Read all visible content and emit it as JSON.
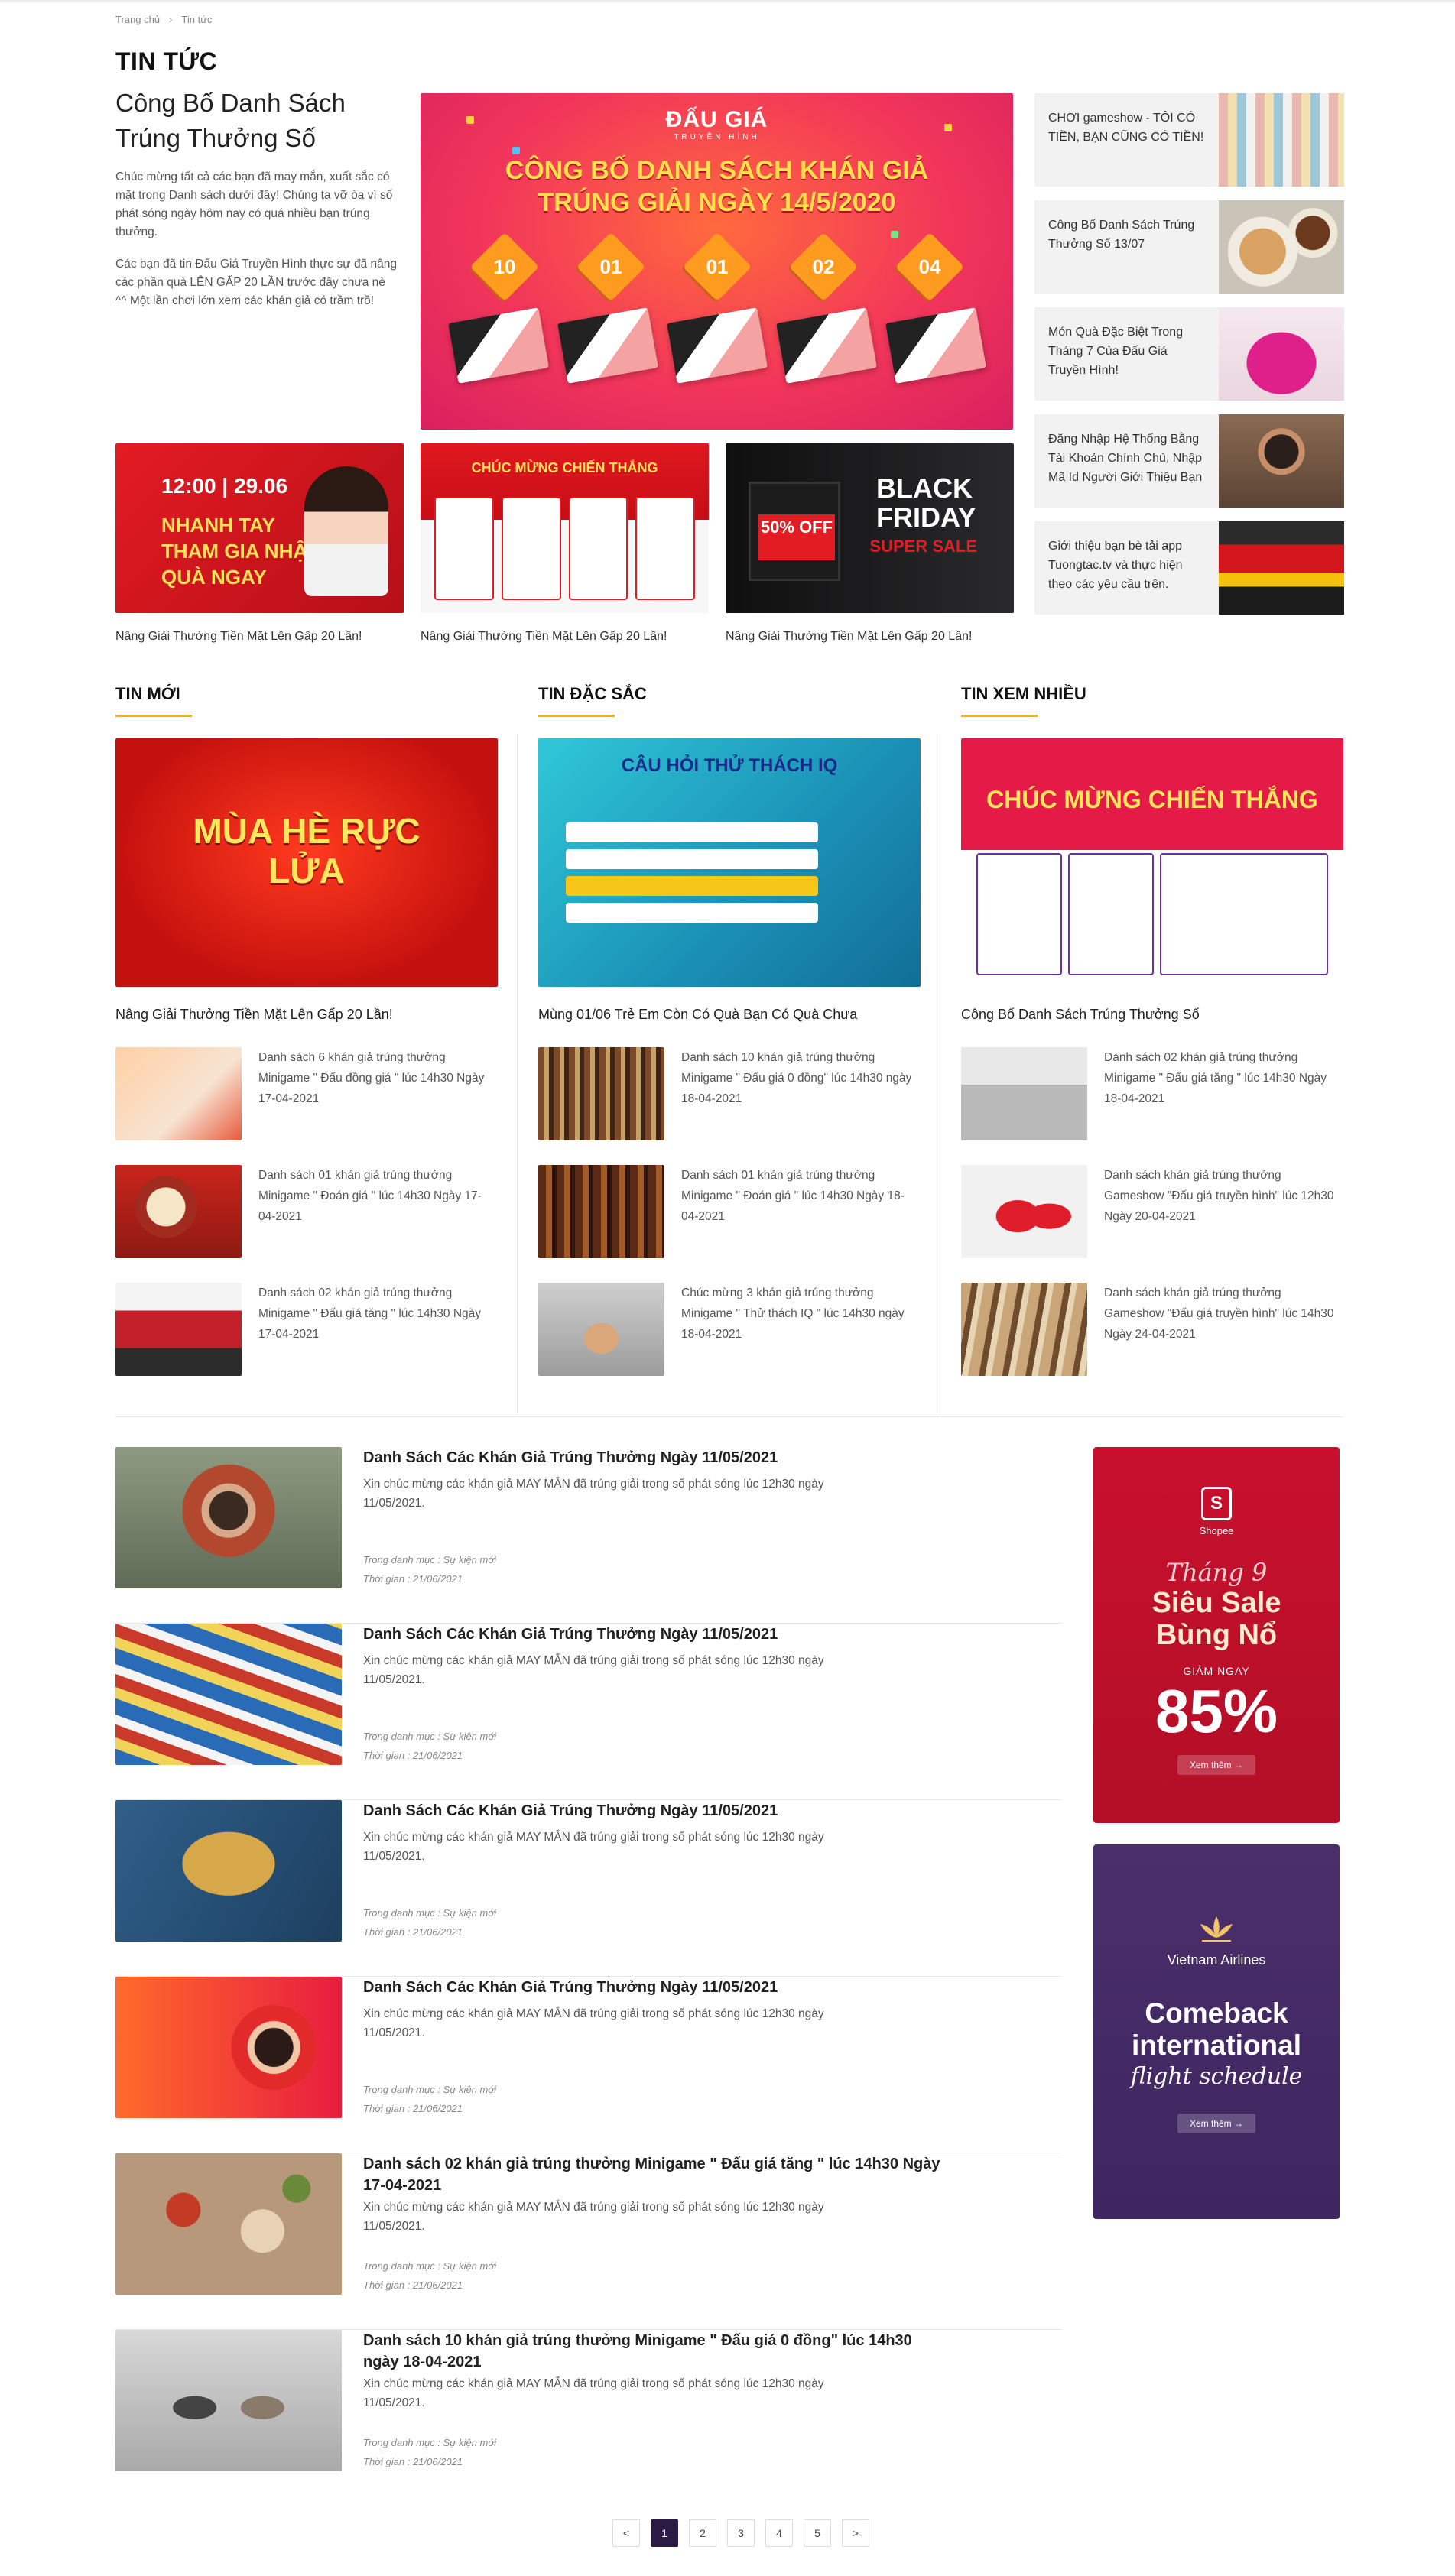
{
  "breadcrumb": {
    "home": "Trang chủ",
    "current": "Tin tức"
  },
  "page_title": "TIN TỨC",
  "featured": {
    "title": "Công Bố Danh Sách Trúng Thưởng Số",
    "p1": "Chúc mừng tất cả các bạn đã may mắn, xuất sắc có mặt trong Danh sách dưới đây! Chúng ta vỡ òa vì số phát sóng ngày hôm nay có quá nhiều bạn trúng thưởng.",
    "p2": "Các bạn đã tin Đấu Giá Truyền Hình thực sự đã nâng các phần quà LÊN GẤP 20 LẦN trước đây chưa nè ^^ Một lần chơi lớn xem các khán giả có trầm trồ!"
  },
  "hero": {
    "brand": "ĐẤU GIÁ",
    "brand_sub": "TRUYỀN HÌNH",
    "headline_1": "CÔNG BỐ DANH SÁCH KHÁN GIẢ",
    "headline_2": "TRÚNG GIẢI NGÀY 14/5/2020",
    "tags": [
      "10",
      "01",
      "01",
      "02",
      "04"
    ]
  },
  "side_list": [
    {
      "title": "CHƠI gameshow - TÔI CÓ TIỀN, BẠN CŨNG CÓ TIỀN!"
    },
    {
      "title": "Công Bố Danh Sách Trúng Thưởng Số 13/07"
    },
    {
      "title": "Món Quà Đặc Biệt Trong Tháng 7 Của Đấu Giá Truyền Hình!"
    },
    {
      "title": "Đăng Nhập Hệ Thống Bằng Tài Khoản Chính Chủ, Nhập Mã Id Người Giới Thiệu Bạn"
    },
    {
      "title": "Giới thiệu bạn bè tải app Tuongtac.tv và thực hiện theo các yêu cầu trên."
    }
  ],
  "mini_banners": [
    {
      "caption": "Nâng Giải Thưởng Tiền Mặt Lên Gấp 20 Lần!",
      "l1": "12:00 | 29.06",
      "l2": "NHANH TAY THAM GIA NHẬN QUÀ NGAY"
    },
    {
      "caption": "Nâng Giải Thưởng Tiền Mặt Lên Gấp 20 Lần!",
      "l1": "CHÚC MỪNG CHIẾN THẮNG"
    },
    {
      "caption": "Nâng Giải Thưởng Tiền Mặt Lên Gấp 20 Lần!",
      "l1": "BLACK FRIDAY",
      "l2": "SUPER SALE",
      "l3": "50% OFF"
    }
  ],
  "sections": [
    {
      "title": "TIN MỚI",
      "big_caption": "Nâng Giải Thưởng Tiền Mặt Lên Gấp 20 Lần!",
      "big_l1": "MÙA HÈ RỰC LỬA",
      "items": [
        {
          "text": "Danh sách 6 khán giả trúng thưởng Minigame \" Đấu đồng giá \" lúc 14h30 Ngày 17-04-2021"
        },
        {
          "text": "Danh sách 01 khán giả trúng thưởng Minigame \" Đoán giá \" lúc 14h30 Ngày 17-04-2021"
        },
        {
          "text": "Danh sách 02 khán giả trúng thưởng Minigame \" Đấu giá tăng \" lúc 14h30 Ngày 17-04-2021"
        }
      ]
    },
    {
      "title": "TIN ĐẶC SẮC",
      "big_caption": "Mùng 01/06 Trẻ Em Còn Có Quà Bạn Có Quà Chưa",
      "big_l1": "CÂU HỎI THỬ THÁCH IQ",
      "items": [
        {
          "text": "Danh sách 10 khán giả trúng thưởng Minigame \" Đấu giá 0 đồng\" lúc 14h30 ngày 18-04-2021"
        },
        {
          "text": "Danh sách 01 khán giả trúng thưởng Minigame \" Đoán giá \" lúc 14h30 Ngày 18-04-2021"
        },
        {
          "text": "Chúc mừng 3 khán giả trúng thưởng Minigame \" Thử thách IQ \" lúc 14h30 ngày 18-04-2021"
        }
      ]
    },
    {
      "title": "TIN XEM NHIỀU",
      "big_caption": "Công Bố Danh Sách Trúng Thưởng Số",
      "big_l1": "CHÚC MỪNG CHIẾN THẮNG",
      "items": [
        {
          "text": "Danh sách 02 khán giả trúng thưởng Minigame \" Đấu giá tăng \" lúc 14h30 Ngày 18-04-2021"
        },
        {
          "text": "Danh sách khán giả trúng thưởng Gameshow \"Đấu giá truyền hình\" lúc 12h30 Ngày 20-04-2021"
        },
        {
          "text": "Danh sách khán giả trúng thưởng Gameshow \"Đấu giá truyền hình\" lúc 14h30 Ngày 24-04-2021"
        }
      ]
    }
  ],
  "posts": [
    {
      "title": "Danh Sách Các Khán Giả Trúng Thưởng Ngày 11/05/2021",
      "desc": "Xin chúc mừng các khán giả MAY MẮN đã trúng giải trong số phát sóng lúc 12h30 ngày 11/05/2021.",
      "category": "Trong danh mục : Sự kiện mới",
      "time": "Thời gian : 21/06/2021"
    },
    {
      "title": "Danh Sách Các Khán Giả Trúng Thưởng Ngày 11/05/2021",
      "desc": "Xin chúc mừng các khán giả MAY MẮN đã trúng giải trong số phát sóng lúc 12h30 ngày 11/05/2021.",
      "category": "Trong danh mục : Sự kiện mới",
      "time": "Thời gian : 21/06/2021"
    },
    {
      "title": "Danh Sách Các Khán Giả Trúng Thưởng Ngày 11/05/2021",
      "desc": "Xin chúc mừng các khán giả MAY MẮN đã trúng giải trong số phát sóng lúc 12h30 ngày 11/05/2021.",
      "category": "Trong danh mục : Sự kiện mới",
      "time": "Thời gian : 21/06/2021"
    },
    {
      "title": "Danh Sách Các Khán Giả Trúng Thưởng Ngày 11/05/2021",
      "desc": "Xin chúc mừng các khán giả MAY MẮN đã trúng giải trong số phát sóng lúc 12h30 ngày 11/05/2021.",
      "category": "Trong danh mục : Sự kiện mới",
      "time": "Thời gian : 21/06/2021"
    },
    {
      "title": "Danh sách 02 khán giả trúng thưởng Minigame \" Đấu giá tăng \" lúc 14h30 Ngày 17-04-2021",
      "desc": "Xin chúc mừng các khán giả MAY MẮN đã trúng giải trong số phát sóng lúc 12h30 ngày 11/05/2021.",
      "category": "Trong danh mục : Sự kiện mới",
      "time": "Thời gian : 21/06/2021"
    },
    {
      "title": "Danh sách 10 khán giả trúng thưởng Minigame \" Đấu giá 0 đồng\" lúc 14h30 ngày 18-04-2021",
      "desc": "Xin chúc mừng các khán giả MAY MẮN đã trúng giải trong số phát sóng lúc 12h30 ngày 11/05/2021.",
      "category": "Trong danh mục : Sự kiện mới",
      "time": "Thời gian : 21/06/2021"
    }
  ],
  "ads": {
    "shopee": {
      "brand": "Shopee",
      "line1": "Tháng 9",
      "line2": "Siêu Sale Bùng Nổ",
      "line3": "GIẢM NGAY",
      "percent": "85%",
      "cta": "Xem thêm →"
    },
    "vietnam_airlines": {
      "brand": "Vietnam Airlines",
      "line1": "Comeback international",
      "line2": "flight schedule",
      "cta": "Xem thêm →"
    }
  },
  "pagination": {
    "prev": "<",
    "pages": [
      "1",
      "2",
      "3",
      "4",
      "5"
    ],
    "next": ">",
    "active": "1"
  },
  "colors": {
    "accent": "#f5b400",
    "brand_red": "#e31b23",
    "pagination_active": "#2a1a44"
  }
}
